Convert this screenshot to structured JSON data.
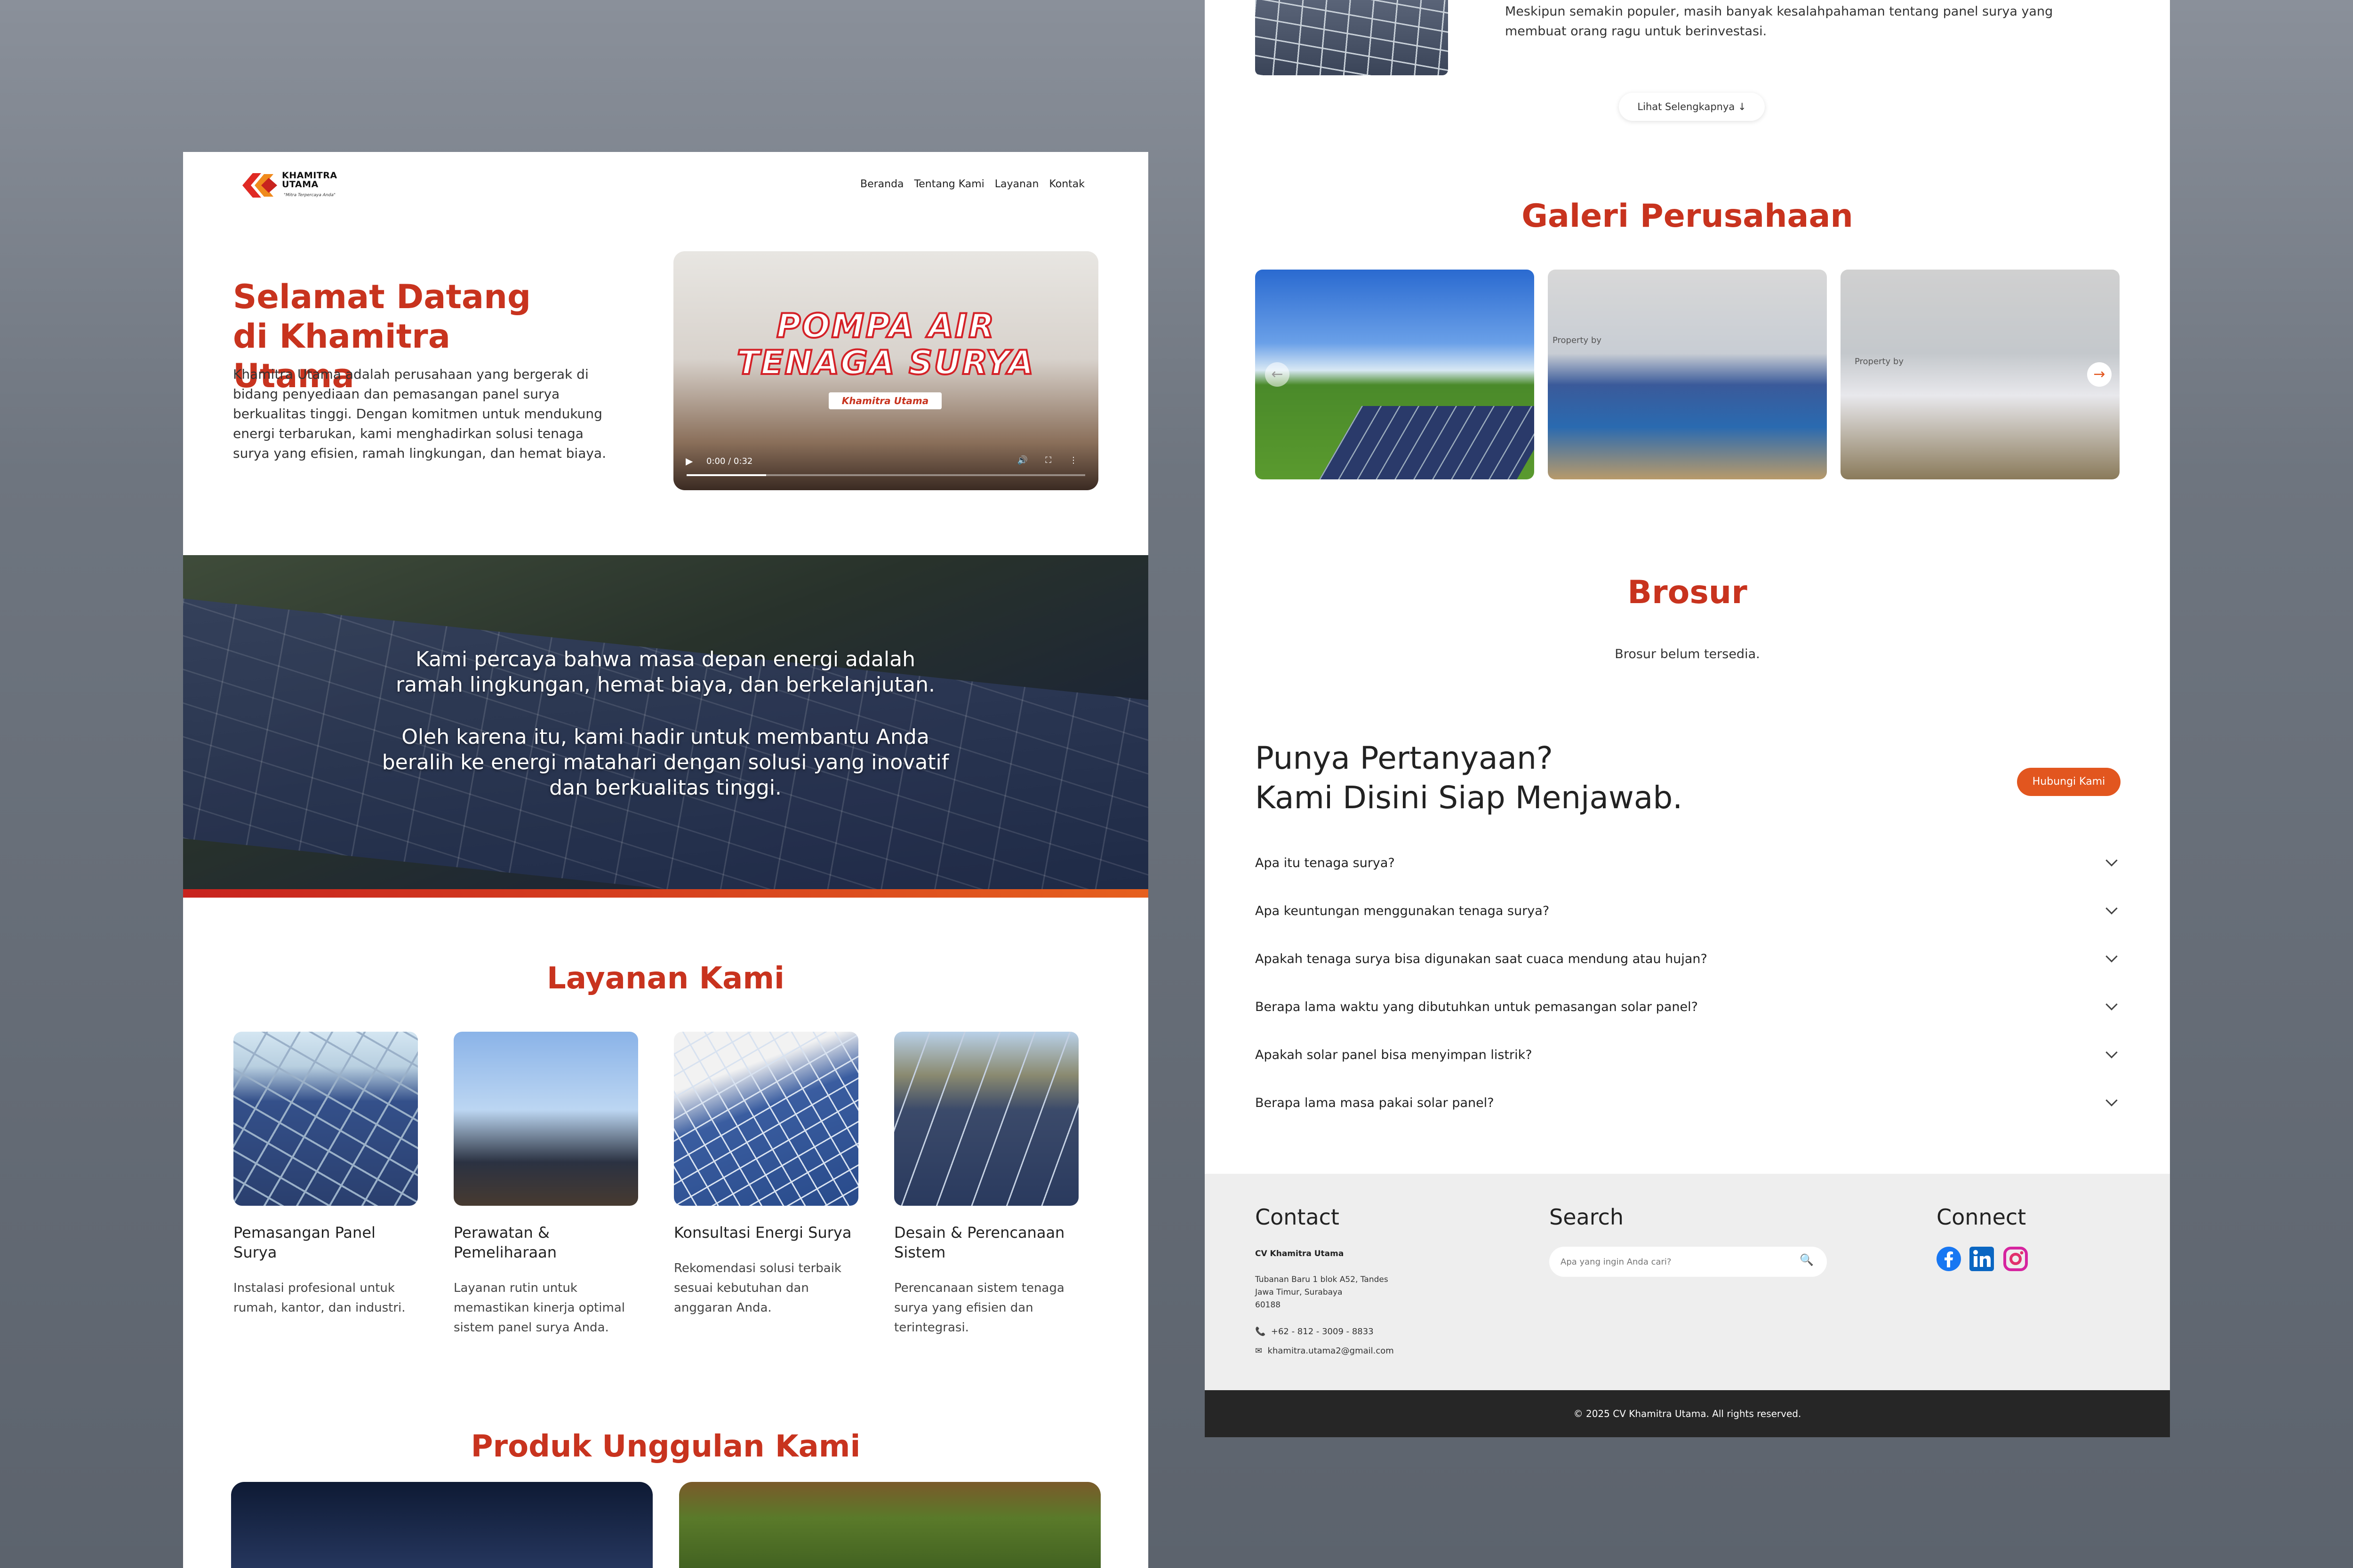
{
  "left": {
    "brand": {
      "name_line1": "KHAMITRA",
      "name_line2": "UTAMA",
      "tagline": "\"Mitra Terpercaya Anda\""
    },
    "nav": [
      "Beranda",
      "Tentang Kami",
      "Layanan",
      "Kontak"
    ],
    "hero": {
      "title": "Selamat Datang di Khamitra Utama",
      "text": "Khamitra Utama adalah perusahaan yang bergerak di bidang penyediaan dan pemasangan panel surya berkualitas tinggi. Dengan komitmen untuk mendukung energi terbarukan, kami menghadirkan solusi tenaga surya yang efisien, ramah lingkungan, dan hemat biaya."
    },
    "video": {
      "title_line1": "POMPA AIR",
      "title_line2": "TENAGA SURYA",
      "subtitle": "Khamitra Utama",
      "time": "0:00 / 0:32",
      "progress": 0.2
    },
    "banner": {
      "line1": "Kami percaya bahwa masa depan energi adalah ramah lingkungan, hemat biaya, dan berkelanjutan.",
      "line2": "Oleh karena itu, kami hadir untuk membantu Anda beralih ke energi matahari dengan solusi yang inovatif dan berkualitas tinggi."
    },
    "services_title": "Layanan Kami",
    "services": [
      {
        "title": "Pemasangan Panel Surya",
        "desc": "Instalasi profesional untuk rumah, kantor, dan industri."
      },
      {
        "title": "Perawatan & Pemeliharaan",
        "desc": "Layanan rutin untuk memastikan kinerja optimal sistem panel surya Anda."
      },
      {
        "title": "Konsultasi Energi Surya",
        "desc": "Rekomendasi solusi terbaik sesuai kebutuhan dan anggaran Anda."
      },
      {
        "title": "Desain & Perencanaan Sistem",
        "desc": "Perencanaan sistem tenaga surya yang efisien dan terintegrasi."
      }
    ],
    "products_title": "Produk Unggulan Kami"
  },
  "right": {
    "blog_text": "Meskipun semakin populer, masih banyak kesalahpahaman tentang panel surya yang membuat orang ragu untuk berinvestasi.",
    "see_more": "Lihat Selengkapnya",
    "gallery_title": "Galeri Perusahaan",
    "gallery_watermark": "Property by",
    "brochure_title": "Brosur",
    "brochure_empty": "Brosur belum tersedia.",
    "faq_title_line1": "Punya Pertanyaan?",
    "faq_title_line2": "Kami Disini Siap Menjawab.",
    "contact_button": "Hubungi Kami",
    "faq": [
      "Apa itu tenaga surya?",
      "Apa keuntungan menggunakan tenaga surya?",
      "Apakah tenaga surya bisa digunakan saat cuaca mendung atau hujan?",
      "Berapa lama waktu yang dibutuhkan untuk pemasangan solar panel?",
      "Apakah solar panel bisa menyimpan listrik?",
      "Berapa lama masa pakai solar panel?"
    ],
    "footer": {
      "contact_heading": "Contact",
      "company": "CV Khamitra Utama",
      "address_line1": "Tubanan Baru 1 blok A52, Tandes",
      "address_line2": "Jawa Timur, Surabaya",
      "address_line3": "60188",
      "phone": "+62 - 812 - 3009 - 8833",
      "email": "khamitra.utama2@gmail.com",
      "search_heading": "Search",
      "search_placeholder": "Apa yang ingin Anda cari?",
      "connect_heading": "Connect",
      "copyright": "© 2025 CV Khamitra Utama. All rights reserved."
    }
  },
  "colors": {
    "accent": "#c8331e",
    "button": "#e2561f",
    "facebook": "#1877f2",
    "linkedin": "#0a66c2",
    "instagram": "#d6249f"
  }
}
